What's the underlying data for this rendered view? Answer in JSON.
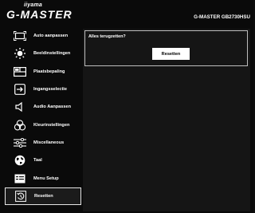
{
  "header": {
    "brand_sub": "iiyama",
    "brand_main": "G-MASTER",
    "model": "G-MASTER GB2730HSU"
  },
  "menu": {
    "items": [
      {
        "label": "Auto aanpassen",
        "icon": "auto-adjust-icon"
      },
      {
        "label": "Beeldinstellingen",
        "icon": "brightness-icon"
      },
      {
        "label": "Plaatsbepaling",
        "icon": "position-icon"
      },
      {
        "label": "Ingangsselectie",
        "icon": "input-icon"
      },
      {
        "label": "Audio Aanpassen",
        "icon": "speaker-icon"
      },
      {
        "label": "Kleurinstellingen",
        "icon": "color-icon"
      },
      {
        "label": "Miscellaneous",
        "icon": "sliders-icon"
      },
      {
        "label": "Taal",
        "icon": "globe-icon"
      },
      {
        "label": "Menu Setup",
        "icon": "menu-setup-icon"
      },
      {
        "label": "Resetten",
        "icon": "reset-icon"
      }
    ],
    "selected_index": 9
  },
  "dialog": {
    "question": "Alles terugzetten?",
    "button_label": "Resetten"
  },
  "colors": {
    "background": "#0a0a0a",
    "panel": "#151515",
    "text": "#ffffff",
    "selection_border": "#e6e6e6"
  }
}
